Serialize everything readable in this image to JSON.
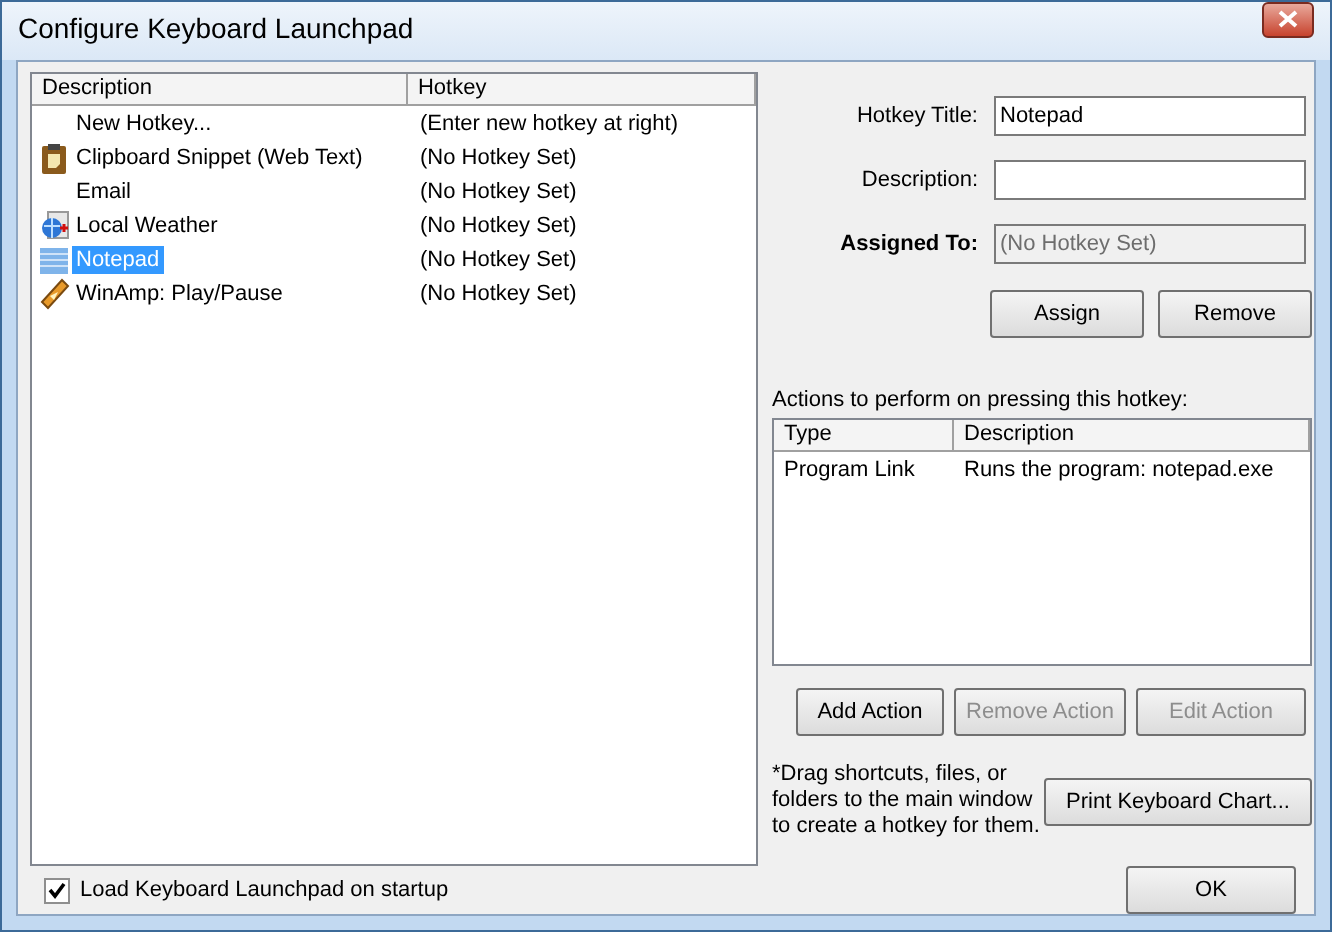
{
  "window": {
    "title": "Configure Keyboard Launchpad"
  },
  "hotkey_list": {
    "columns": [
      "Description",
      "Hotkey"
    ],
    "rows": [
      {
        "kind": "none",
        "description": "New Hotkey...",
        "hotkey": "(Enter new hotkey at right)",
        "selected": false
      },
      {
        "kind": "clipboard",
        "description": "Clipboard Snippet (Web Text)",
        "hotkey": "(No Hotkey Set)",
        "selected": false
      },
      {
        "kind": "none",
        "description": "Email",
        "hotkey": "(No Hotkey Set)",
        "selected": false
      },
      {
        "kind": "globe",
        "description": "Local Weather",
        "hotkey": "(No Hotkey Set)",
        "selected": false
      },
      {
        "kind": "notepad",
        "description": "Notepad",
        "hotkey": "(No Hotkey Set)",
        "selected": true
      },
      {
        "kind": "winamp",
        "description": "WinAmp: Play/Pause",
        "hotkey": "(No Hotkey Set)",
        "selected": false
      }
    ]
  },
  "form": {
    "fields": [
      {
        "label": "Hotkey Title:",
        "value": "Notepad",
        "disabled": false,
        "bold": false
      },
      {
        "label": "Description:",
        "disabled": false,
        "bold": false
      },
      {
        "label": "Assigned To:",
        "value": "(No Hotkey Set)",
        "disabled": true,
        "bold": true
      }
    ],
    "buttons": [
      {
        "label": "Assign",
        "disabled": false
      },
      {
        "label": "Remove",
        "disabled": false
      }
    ]
  },
  "actions": {
    "label": "Actions to perform on pressing this hotkey:",
    "columns": [
      "Type",
      "Description"
    ],
    "rows": [
      {
        "type": "Program Link",
        "description": "Runs the program: notepad.exe"
      }
    ],
    "buttons": [
      {
        "label": "Add Action",
        "disabled": false
      },
      {
        "label": "Remove Action",
        "disabled": true
      },
      {
        "label": "Edit Action",
        "disabled": true
      }
    ]
  },
  "note": "*Drag shortcuts, files, or folders to the main window to create a hotkey for them.",
  "print_button": "Print Keyboard Chart...",
  "startup_checkbox": {
    "label": "Load Keyboard Launchpad on startup",
    "checked": true
  },
  "ok_button": "OK"
}
